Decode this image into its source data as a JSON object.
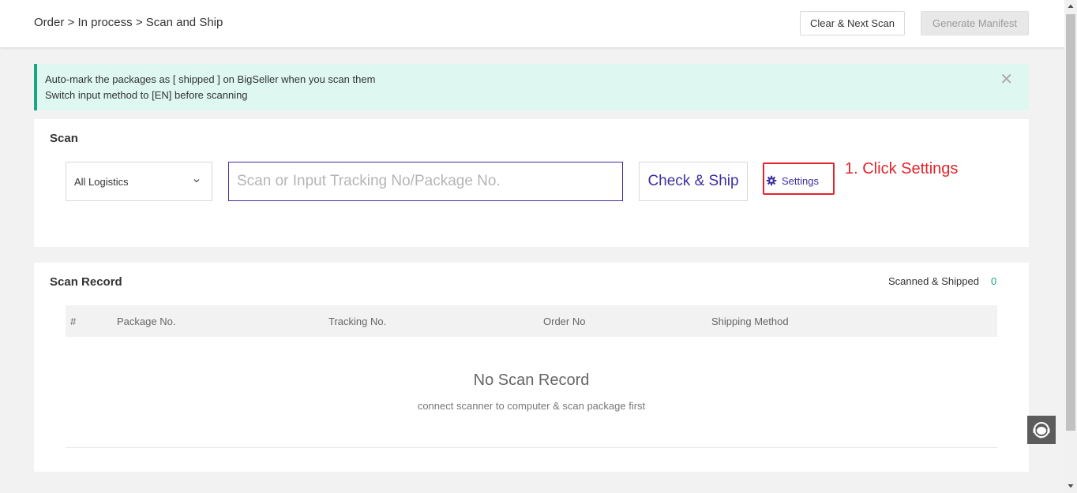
{
  "breadcrumb": {
    "order": "Order",
    "sep1": ">",
    "in_process": "In process",
    "sep2": ">",
    "current": "Scan and Ship"
  },
  "toolbar": {
    "clear_label": "Clear & Next Scan",
    "manifest_label": "Generate Manifest"
  },
  "notice": {
    "line1": "Auto-mark the packages as [ shipped ] on BigSeller when you scan them",
    "line2": "Switch input method to [EN] before scanning",
    "close_icon": "close-icon"
  },
  "scan": {
    "title": "Scan",
    "logistics_selected": "All Logistics",
    "input_value": "",
    "input_placeholder": "Scan or Input Tracking No/Package No.",
    "check_ship_label": "Check & Ship",
    "settings_label": "Settings",
    "settings_icon": "gear-icon"
  },
  "annotation": {
    "text": "1. Click Settings"
  },
  "record": {
    "title": "Scan Record",
    "scanned_label": "Scanned & Shipped",
    "scanned_count": "0",
    "columns": [
      "#",
      "Package No.",
      "Tracking No.",
      "Order No",
      "Shipping Method"
    ],
    "empty_title": "No Scan Record",
    "empty_subtitle": "connect scanner to computer & scan package first"
  },
  "colors": {
    "accent": "#3d2fa0",
    "success": "#18a887",
    "notice_bg": "#def7f1",
    "annotation_red": "#e3242b"
  }
}
